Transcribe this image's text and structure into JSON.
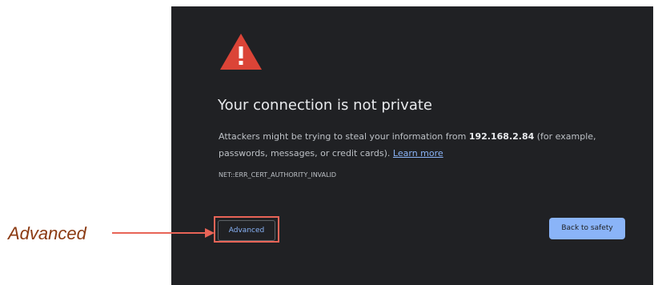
{
  "interstitial": {
    "title": "Your connection is not private",
    "description": {
      "before_host": "Attackers might be trying to steal your information from ",
      "host": "192.168.2.84",
      "after_host": " (for example, passwords, messages, or credit cards). ",
      "learn_more": "Learn more"
    },
    "error_code": "NET::ERR_CERT_AUTHORITY_INVALID",
    "advanced_label": "Advanced",
    "back_label": "Back to safety",
    "icon": "warning-triangle-icon"
  },
  "annotation": {
    "label": "Advanced",
    "color": "#e86457",
    "label_color": "#8b3a12"
  },
  "colors": {
    "background": "#202124",
    "title": "#e8eaed",
    "body_text": "#bdc1c6",
    "link": "#8ab4f8",
    "primary_button": "#8ab4f8",
    "warning_red": "#db4437"
  }
}
